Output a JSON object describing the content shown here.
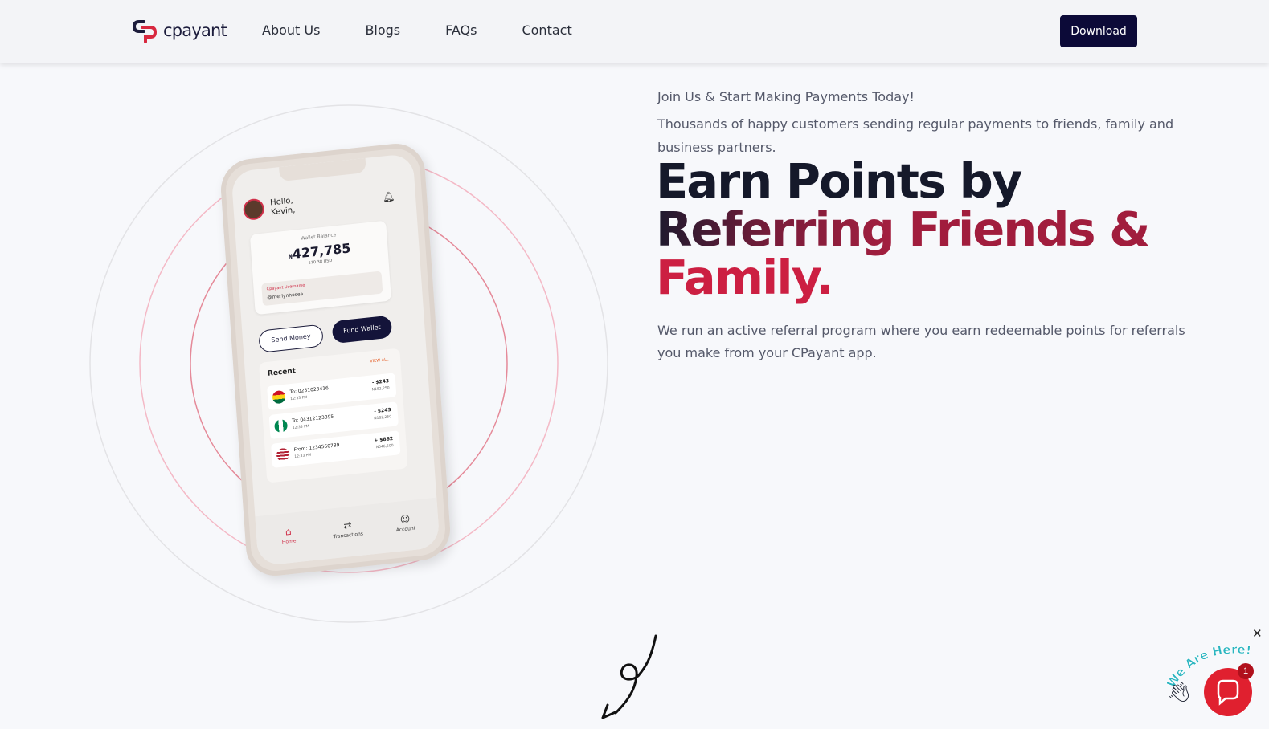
{
  "header": {
    "logo_text": "cpayant",
    "nav": [
      "About Us",
      "Blogs",
      "FAQs",
      "Contact"
    ],
    "download_label": "Download"
  },
  "hero": {
    "eyebrow": "Join Us & Start Making Payments Today!",
    "intro": "Thousands of happy customers sending regular payments to friends, family and business partners.",
    "headline_part1": "Earn Points by",
    "headline_part2": "Referring",
    "headline_part3": "Friends &",
    "headline_part4": "Family.",
    "description": "We run an active referral program where you earn redeemable points for referrals you make from your CPayant app."
  },
  "phone": {
    "greeting_line1": "Hello,",
    "greeting_line2": "Kevin,",
    "wallet_label": "Wallet Balance",
    "wallet_currency": "₦",
    "wallet_amount": "427,785",
    "wallet_usd": "570.38 USD",
    "username_label": "Cpayant Username",
    "username_value": "@merlynhosea",
    "send_label": "Send Money",
    "fund_label": "Fund Wallet",
    "recent_title": "Recent",
    "view_all": "VIEW ALL",
    "transactions": [
      {
        "who": "To: 0251023416",
        "time": "12:33 PM",
        "amount": "- $243",
        "ngn": "N182,250"
      },
      {
        "who": "To: 04312123895",
        "time": "12:33 PM",
        "amount": "- $243",
        "ngn": "N182,250"
      },
      {
        "who": "From: 1234560789",
        "time": "12:33 PM",
        "amount": "+ $862",
        "ngn": "N646,500"
      }
    ],
    "tabs": [
      "Home",
      "Transactions",
      "Account"
    ]
  },
  "chat": {
    "label": "We Are Here!",
    "badge": "1",
    "close": "✕"
  },
  "colors": {
    "primary_dark": "#0c0a38",
    "accent_red": "#cc1f42",
    "accent_wine": "#a11d3d"
  }
}
